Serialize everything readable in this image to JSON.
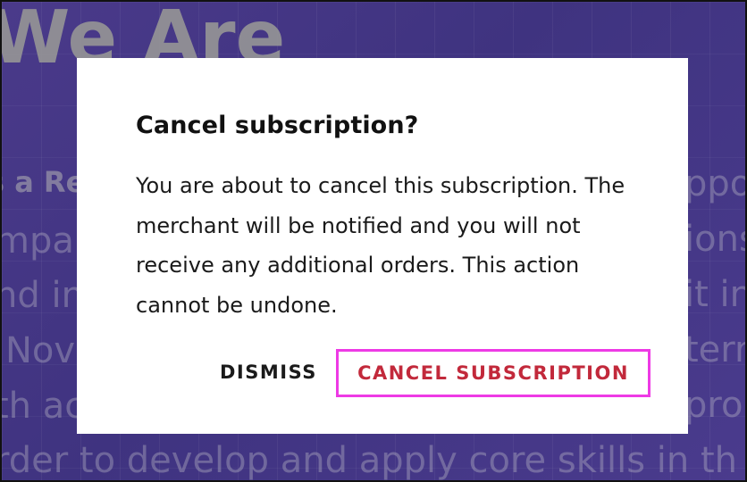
{
  "background": {
    "headline": "We Are",
    "subhead": "s a Re",
    "left_lines": [
      "mpa",
      "nd in",
      "Nov",
      "th ac",
      "rder to develop and apply core skills in th"
    ],
    "right_lines": [
      "ppo",
      "ions",
      "it in",
      "tern",
      "pro"
    ],
    "color": "#4b3a8c"
  },
  "dialog": {
    "title": "Cancel subscription?",
    "body": "You are about to cancel this subscription. The merchant will be notified and you will not receive any additional orders. This action cannot be undone.",
    "dismiss_label": "DISMISS",
    "confirm_label": "CANCEL SUBSCRIPTION",
    "confirm_color": "#c2293b",
    "focus_ring_color": "#ee3ae5"
  }
}
